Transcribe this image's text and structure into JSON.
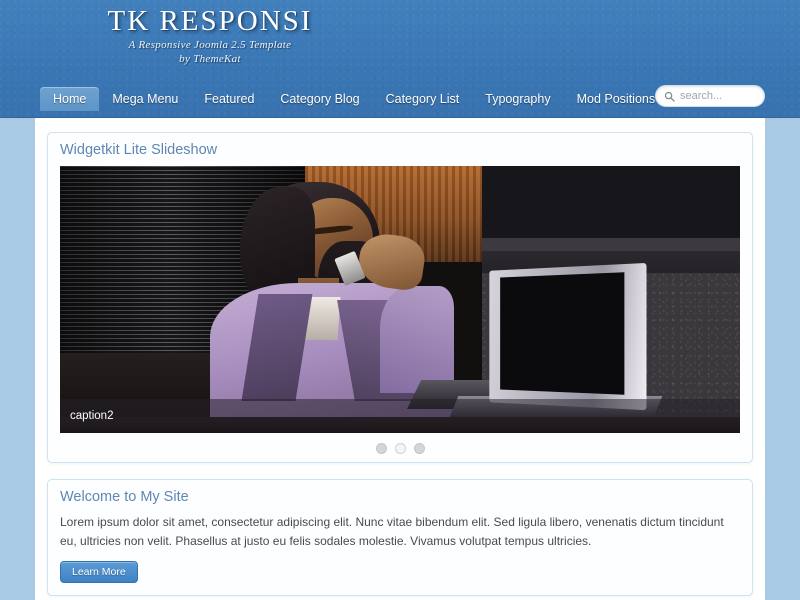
{
  "header": {
    "logo_title": "TK RESPONSI",
    "tagline_line1": "A Responsive Joomla 2.5 Template",
    "tagline_line2": "by ThemeKat",
    "brand_blue": "#3a77b4",
    "page_bg": "#a9cae5"
  },
  "nav": {
    "items": [
      {
        "label": "Home",
        "active": true
      },
      {
        "label": "Mega Menu",
        "active": false
      },
      {
        "label": "Featured",
        "active": false
      },
      {
        "label": "Category Blog",
        "active": false
      },
      {
        "label": "Category List",
        "active": false
      },
      {
        "label": "Typography",
        "active": false
      },
      {
        "label": "Mod Positions",
        "active": false
      }
    ]
  },
  "search": {
    "placeholder": "search...",
    "value": "",
    "icon": "search-icon"
  },
  "slideshow": {
    "heading": "Widgetkit Lite Slideshow",
    "caption": "caption2",
    "dots": [
      {
        "active": false
      },
      {
        "active": true
      },
      {
        "active": false
      }
    ]
  },
  "welcome": {
    "heading": "Welcome to My Site",
    "paragraph": "Lorem ipsum dolor sit amet, consectetur adipiscing elit. Nunc vitae bibendum elit. Sed ligula libero, venenatis dictum tincidunt eu, ultricies non velit. Phasellus at justo eu felis sodales molestie. Vivamus volutpat tempus ultricies.",
    "button_label": "Learn More"
  }
}
